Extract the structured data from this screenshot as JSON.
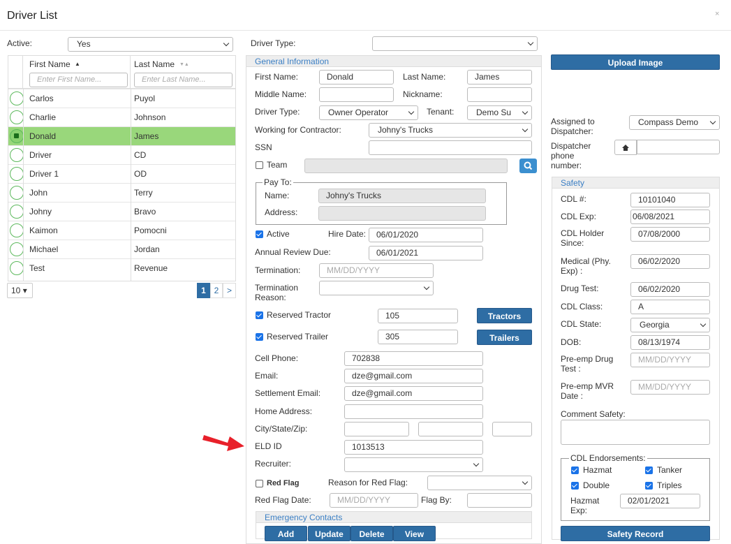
{
  "dialog": {
    "title": "Driver List",
    "close": "×"
  },
  "filters": {
    "active_label": "Active:",
    "active_value": "Yes",
    "driver_type_label": "Driver Type:",
    "driver_type_value": ""
  },
  "grid": {
    "columns": [
      {
        "label": "First Name",
        "sort": "▲",
        "placeholder": "Enter First Name..."
      },
      {
        "label": "Last Name",
        "sort": "▼▲",
        "placeholder": "Enter Last Name..."
      }
    ],
    "rows": [
      {
        "first": "Carlos",
        "last": "Puyol",
        "selected": false
      },
      {
        "first": "Charlie",
        "last": "Johnson",
        "selected": false
      },
      {
        "first": "Donald",
        "last": "James",
        "selected": true
      },
      {
        "first": "Driver",
        "last": "CD",
        "selected": false
      },
      {
        "first": "Driver 1",
        "last": "OD",
        "selected": false
      },
      {
        "first": "John",
        "last": "Terry",
        "selected": false
      },
      {
        "first": "Johny",
        "last": "Bravo",
        "selected": false
      },
      {
        "first": "Kaimon",
        "last": "Pomocni",
        "selected": false
      },
      {
        "first": "Michael",
        "last": "Jordan",
        "selected": false
      },
      {
        "first": "Test",
        "last": "Revenue",
        "selected": false
      }
    ],
    "page_size": "10",
    "pages": [
      "1",
      "2",
      ">"
    ]
  },
  "general": {
    "header": "General Information",
    "first_name_label": "First Name:",
    "first_name": "Donald",
    "last_name_label": "Last Name:",
    "last_name": "James",
    "middle_name_label": "Middle Name:",
    "middle_name": "",
    "nickname_label": "Nickname:",
    "nickname": "",
    "driver_type_label": "Driver Type:",
    "driver_type": "Owner Operator",
    "tenant_label": "Tenant:",
    "tenant": "Demo Su",
    "contractor_label": "Working for Contractor:",
    "contractor": "Johny's Trucks",
    "ssn_label": "SSN",
    "ssn": "",
    "team_label": "Team",
    "payto_legend": "Pay To:",
    "payto_name_label": "Name:",
    "payto_name": "Johny's Trucks",
    "payto_address_label": "Address:",
    "payto_address": "",
    "active_label": "Active",
    "hire_date_label": "Hire Date:",
    "hire_date": "06/01/2020",
    "annual_review_label": "Annual Review Due:",
    "annual_review": "06/01/2021",
    "termination_label": "Termination:",
    "termination_placeholder": "MM/DD/YYYY",
    "termination_reason_label": "Termination Reason:",
    "reserved_tractor_label": "Reserved Tractor",
    "reserved_tractor": "105",
    "tractors_button": "Tractors",
    "reserved_trailer_label": "Reserved Trailer",
    "reserved_trailer": "305",
    "trailers_button": "Trailers",
    "cell_phone_label": "Cell Phone:",
    "cell_phone": "702838",
    "email_label": "Email:",
    "email": "dze@gmail.com",
    "settlement_email_label": "Settlement Email:",
    "settlement_email": "dze@gmail.com",
    "home_address_label": "Home Address:",
    "home_address": "",
    "csz_label": "City/State/Zip:",
    "eld_label": "ELD ID",
    "eld": "1013513",
    "recruiter_label": "Recruiter:",
    "recruiter": "",
    "red_flag_label": "Red Flag",
    "red_flag_reason_label": "Reason for Red Flag:",
    "red_flag_date_label": "Red Flag Date:",
    "red_flag_date_placeholder": "MM/DD/YYYY",
    "flag_by_label": "Flag By:",
    "emergency_header": "Emergency Contacts",
    "emergency_buttons": [
      "Add",
      "Update",
      "Delete",
      "View"
    ]
  },
  "right": {
    "upload_button": "Upload Image",
    "dispatcher_label": "Assigned to Dispatcher:",
    "dispatcher": "Compass Demo",
    "dispatcher_phone_label": "Dispatcher phone number:",
    "dispatcher_phone": "",
    "safety_header": "Safety",
    "cdl_num_label": "CDL #:",
    "cdl_num": "10101040",
    "cdl_exp_label": "CDL Exp:",
    "cdl_exp": "06/08/2021",
    "cdl_holder_label": "CDL Holder Since:",
    "cdl_holder": "07/08/2000",
    "medical_label": "Medical (Phy. Exp) :",
    "medical": "06/02/2020",
    "drug_test_label": "Drug Test:",
    "drug_test": "06/02/2020",
    "cdl_class_label": "CDL Class:",
    "cdl_class": "A",
    "cdl_state_label": "CDL State:",
    "cdl_state": "Georgia",
    "dob_label": "DOB:",
    "dob": "08/13/1974",
    "preemp_drug_label": "Pre-emp Drug Test :",
    "preemp_drug_placeholder": "MM/DD/YYYY",
    "preemp_mvr_label": "Pre-emp MVR Date :",
    "preemp_mvr_placeholder": "MM/DD/YYYY",
    "comment_label": "Comment Safety:",
    "endorsements_legend": "CDL Endorsements:",
    "hazmat_label": "Hazmat",
    "tanker_label": "Tanker",
    "double_label": "Double",
    "triples_label": "Triples",
    "hazmat_exp_label": "Hazmat Exp:",
    "hazmat_exp": "02/01/2021",
    "safety_record_button": "Safety Record"
  },
  "colors": {
    "accent": "#2e6da4",
    "selected_row": "#99d77b",
    "arrow": "#e8202a",
    "checkbox": "#1a73e8"
  }
}
